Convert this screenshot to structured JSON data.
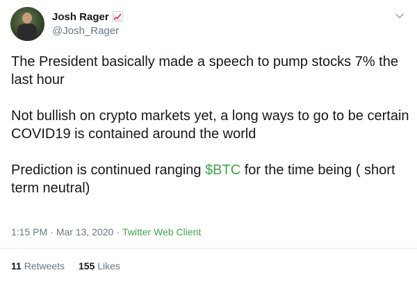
{
  "author": {
    "display_name": "Josh Rager",
    "handle": "@Josh_Rager",
    "badge_icon": "chart-increasing-icon"
  },
  "tweet": {
    "paragraphs": [
      {
        "text": "The President basically made a speech to pump stocks 7% the last hour"
      },
      {
        "text": "Not bullish on crypto markets yet, a long ways to go to be certain COVID19 is contained around the world"
      },
      {
        "before": "Prediction is continued ranging ",
        "cashtag": "$BTC",
        "after": " for the time being ( short term neutral)"
      }
    ]
  },
  "meta": {
    "time": "1:15 PM",
    "date": "Mar 13, 2020",
    "separator": "·",
    "source": "Twitter Web Client"
  },
  "stats": {
    "retweets_count": "11",
    "retweets_label": "Retweets",
    "likes_count": "155",
    "likes_label": "Likes"
  },
  "colors": {
    "cashtag": "#3fa54a",
    "source": "#3fa54a",
    "secondary_text": "#657786"
  }
}
